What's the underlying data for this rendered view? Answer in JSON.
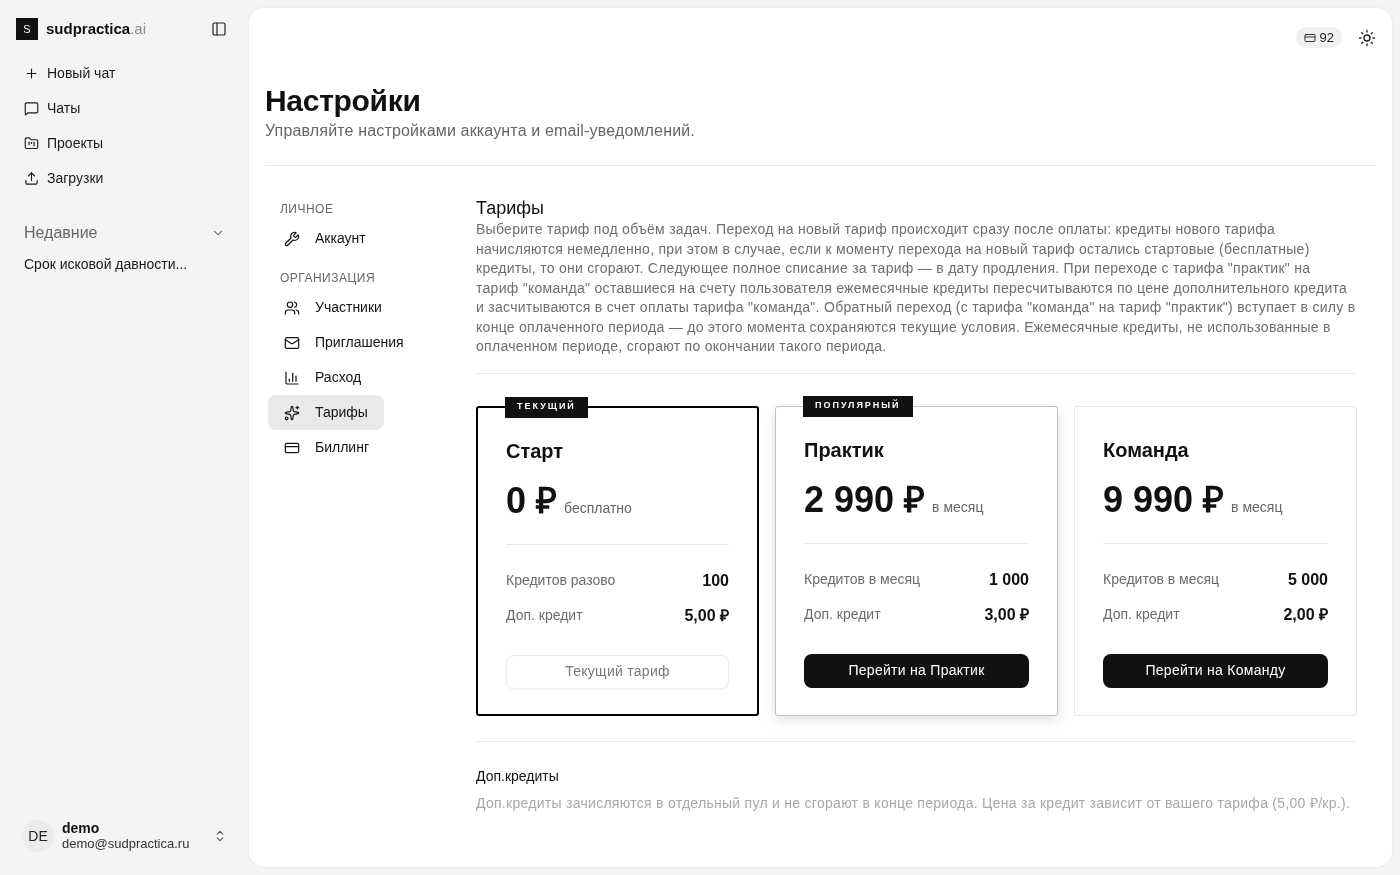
{
  "sidebar": {
    "logo": {
      "mark": "S",
      "name": "sudpractica",
      "suffix": ".ai"
    },
    "nav": [
      {
        "label": "Новый чат"
      },
      {
        "label": "Чаты"
      },
      {
        "label": "Проекты"
      },
      {
        "label": "Загрузки"
      }
    ],
    "recent": {
      "title": "Недавние",
      "expanded": true,
      "items": [
        {
          "label": "Срок исковой давности..."
        }
      ]
    },
    "user": {
      "initials": "DE",
      "name": "demo",
      "email": "demo@sudpractica.ru"
    }
  },
  "header": {
    "credits": "92"
  },
  "page": {
    "title": "Настройки",
    "subtitle": "Управляйте настройками аккаунта и email-уведомлений."
  },
  "settings_nav": {
    "sections": [
      {
        "title": "ЛИЧНОЕ",
        "items": [
          {
            "label": "Аккаунт",
            "selected": false
          }
        ]
      },
      {
        "title": "ОРГАНИЗАЦИЯ",
        "items": [
          {
            "label": "Участники",
            "selected": false
          },
          {
            "label": "Приглашения",
            "selected": false
          },
          {
            "label": "Расход",
            "selected": false
          },
          {
            "label": "Тарифы",
            "selected": true
          },
          {
            "label": "Биллинг",
            "selected": false
          }
        ]
      }
    ]
  },
  "plans_section": {
    "title": "Тарифы",
    "description": "Выберите тариф под объём задач. Переход на новый тариф происходит сразу после оплаты: кредиты нового тарифа начисляются немедленно, при этом в случае, если к моменту перехода на новый тариф остались стартовые (бесплатные) кредиты, то они сгорают. Следующее полное списание за тариф — в дату продления. При переходе с тарифа \"практик\" на тариф \"команда\" оставшиеся на счету пользователя ежемесячные кредиты пересчитываются по цене дополнительного кредита и засчитываются в счет оплаты тарифа \"команда\". Обратный переход (с тарифа \"команда\" на тариф \"практик\") вступает в силу в конце оплаченного периода — до этого момента сохраняются текущие условия. Ежемесячные кредиты, не использованные в оплаченном периоде, сгорают по окончании такого периода.",
    "plans": [
      {
        "kind": "current",
        "badge": "ТЕКУЩИЙ",
        "name": "Старт",
        "price": "0 ₽",
        "period": "бесплатно",
        "rows": [
          {
            "label": "Кредитов разово",
            "value": "100"
          },
          {
            "label": "Доп. кредит",
            "value": "5,00 ₽"
          }
        ],
        "action": {
          "label": "Текущий тариф",
          "disabled": true
        }
      },
      {
        "kind": "popular",
        "badge": "ПОПУЛЯРНЫЙ",
        "name": "Практик",
        "price": "2 990 ₽",
        "period": "в месяц",
        "rows": [
          {
            "label": "Кредитов в месяц",
            "value": "1 000"
          },
          {
            "label": "Доп. кредит",
            "value": "3,00 ₽"
          }
        ],
        "action": {
          "label": "Перейти на Практик",
          "disabled": false
        }
      },
      {
        "kind": "standard",
        "name": "Команда",
        "price": "9 990 ₽",
        "period": "в месяц",
        "rows": [
          {
            "label": "Кредитов в месяц",
            "value": "5 000"
          },
          {
            "label": "Доп. кредит",
            "value": "2,00 ₽"
          }
        ],
        "action": {
          "label": "Перейти на Команду",
          "disabled": false
        }
      }
    ]
  },
  "extra_credits": {
    "title": "Доп.кредиты",
    "description": "Доп.кредиты зачисляются в отдельный пул и не сгорают в конце периода. Цена за кредит зависит от вашего тарифа (5,00 ₽/кр.)."
  }
}
